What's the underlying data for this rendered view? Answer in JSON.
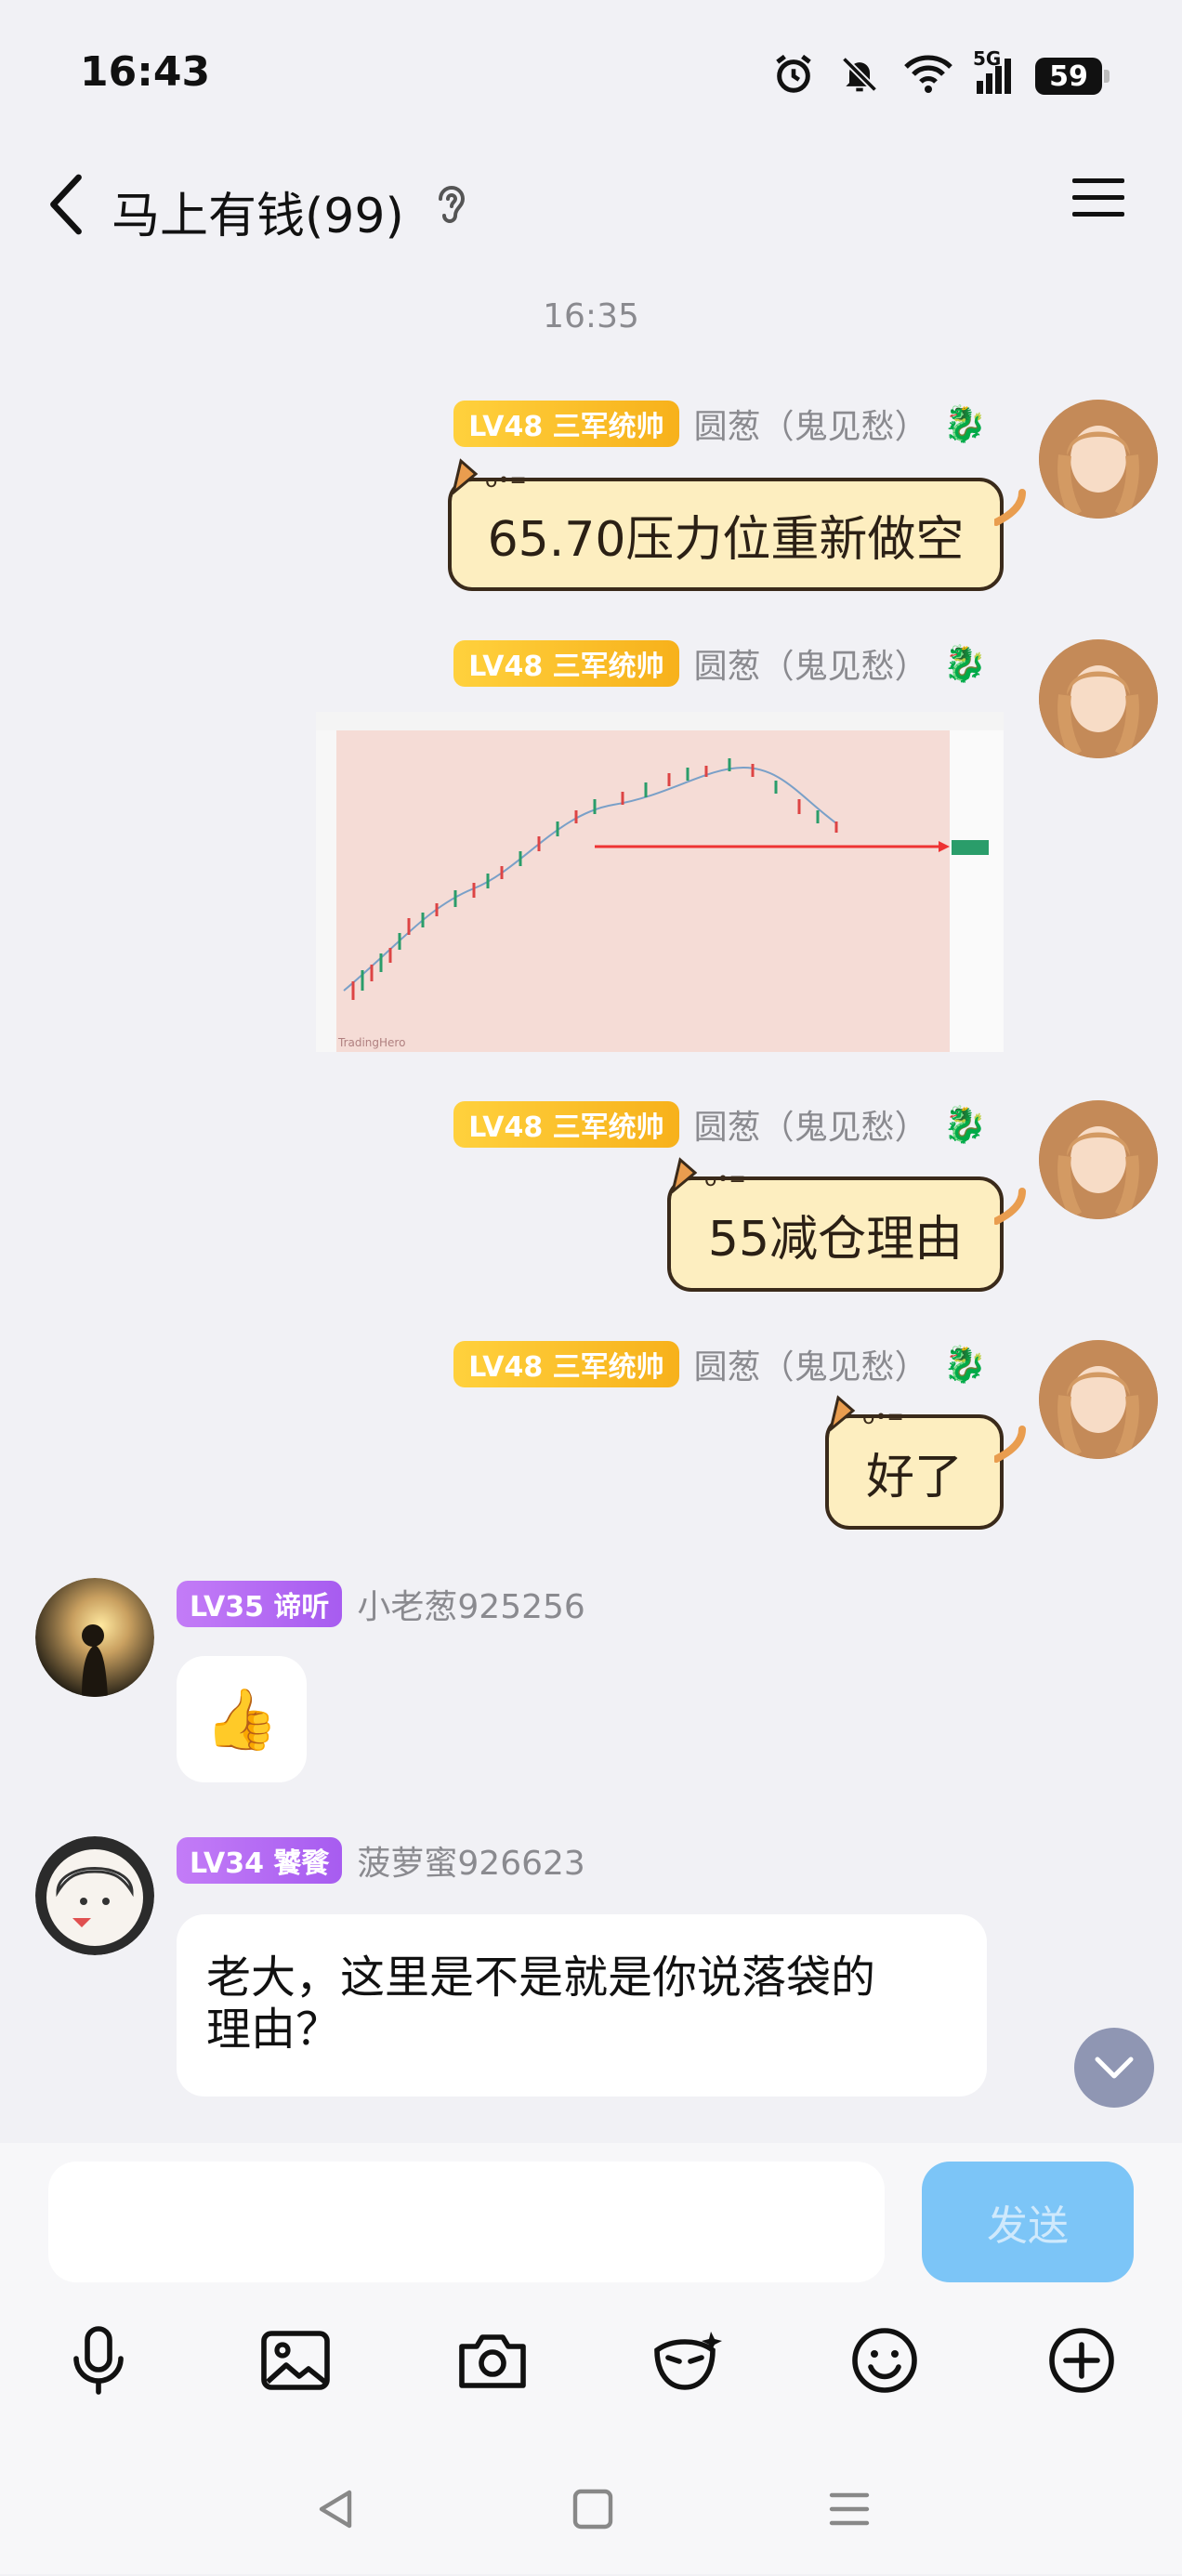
{
  "status_bar": {
    "time": "16:43",
    "network": "5G",
    "battery": "59"
  },
  "header": {
    "title": "马上有钱(99)"
  },
  "chat": {
    "timestamp": "16:35",
    "messages": [
      {
        "badge": "LV48 三军统帅",
        "sender": "圆葱（鬼见愁）",
        "text": "65.70压力位重新做空"
      },
      {
        "badge": "LV48 三军统帅",
        "sender": "圆葱（鬼见愁）",
        "image": "trading-chart-screenshot"
      },
      {
        "badge": "LV48 三军统帅",
        "sender": "圆葱（鬼见愁）",
        "text": "55减仓理由"
      },
      {
        "badge": "LV48 三军统帅",
        "sender": "圆葱（鬼见愁）",
        "text": "好了"
      },
      {
        "badge": "LV35 谛听",
        "sender": "小老葱925256",
        "emoji": "👍"
      },
      {
        "badge": "LV34 饕餮",
        "sender": "菠萝蜜926623",
        "text_line1": "老大，这里是不是就是你说落袋的",
        "text_line2": "理由？"
      }
    ]
  },
  "composer": {
    "input_value": "",
    "send_label": "发送"
  },
  "colors": {
    "gold_badge": "#f7b11b",
    "purple_badge": "#a75cf0",
    "cat_bubble": "#fdeec0",
    "send_button": "#7cc5f7"
  }
}
